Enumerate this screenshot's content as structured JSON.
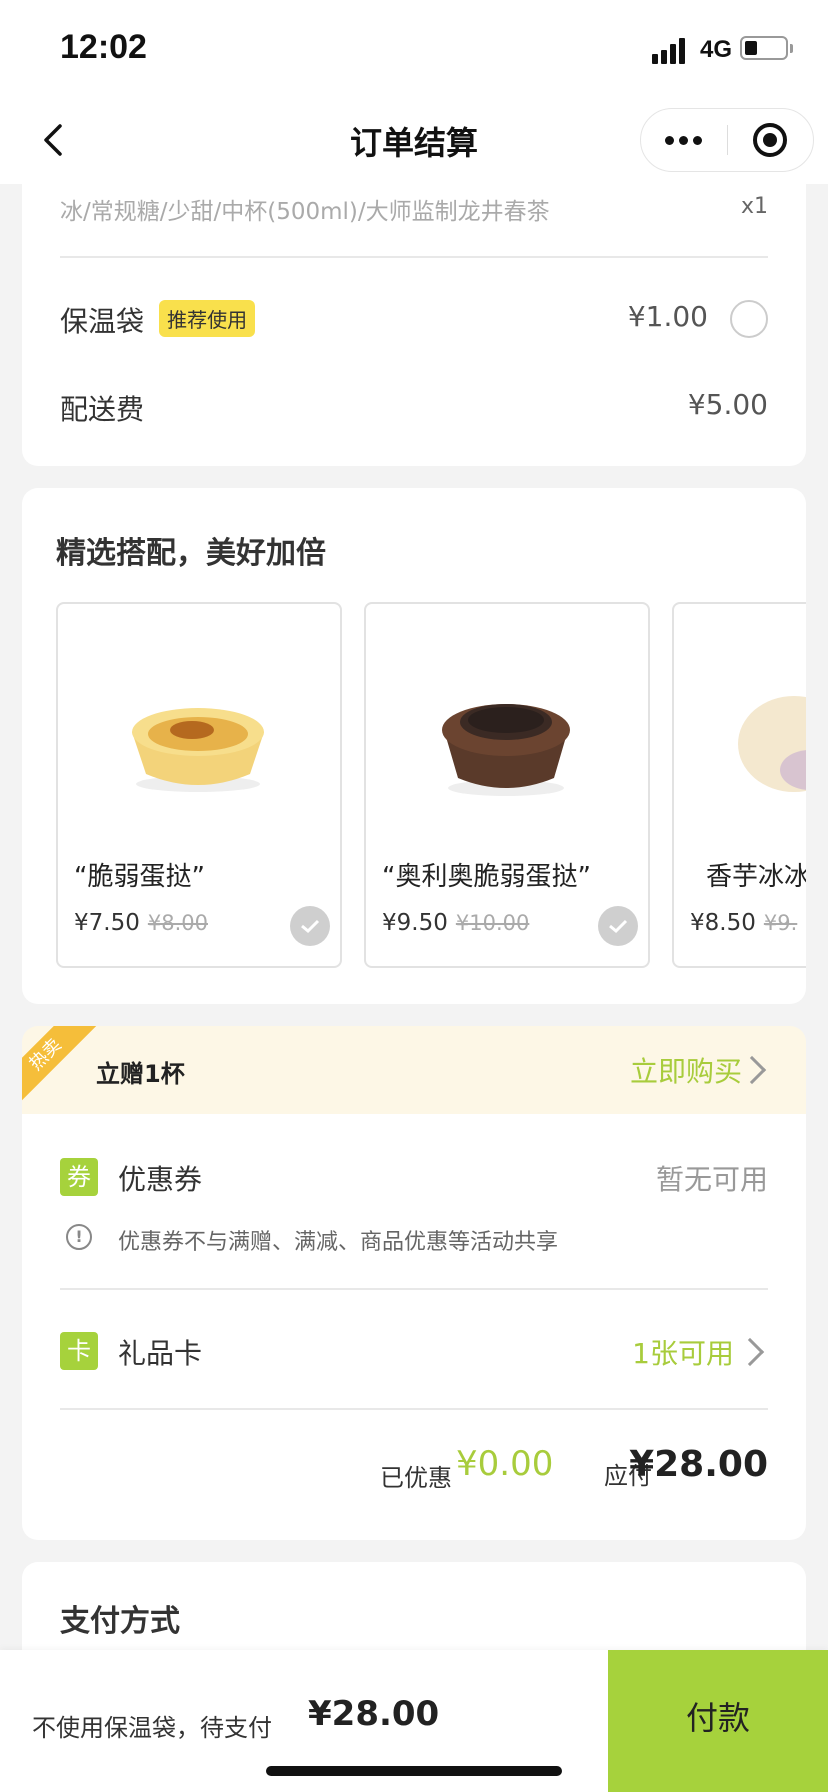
{
  "status_bar": {
    "time": "12:02",
    "network": "4G"
  },
  "nav": {
    "title": "订单结算"
  },
  "order": {
    "spec": "冰/常规糖/少甜/中杯(500ml)/大师监制龙井春茶",
    "qty": "x1",
    "bag_label": "保温袋",
    "bag_tag": "推荐使用",
    "bag_price": "¥1.00",
    "delivery_label": "配送费",
    "delivery_price": "¥5.00"
  },
  "combo": {
    "title": "精选搭配，美好加倍",
    "products": [
      {
        "name": "“脆弱蛋挞”",
        "price": "¥7.50",
        "original": "¥8.00"
      },
      {
        "name": "“奥利奥脆弱蛋挞”",
        "price": "¥9.50",
        "original": "¥10.00"
      },
      {
        "name": "香芋冰冰",
        "price": "¥8.50",
        "original": "¥9."
      }
    ]
  },
  "promo": {
    "ribbon": "热卖",
    "title": "立赠1杯",
    "action": "立即购买"
  },
  "discount": {
    "coupon_icon": "券",
    "coupon_label": "优惠券",
    "coupon_status": "暂无可用",
    "coupon_note": "优惠券不与满赠、满减、商品优惠等活动共享",
    "giftcard_icon": "卡",
    "giftcard_label": "礼品卡",
    "giftcard_status": "1张可用",
    "saved_label": "已优惠",
    "saved_value": "¥0.00",
    "payable_label": "应付",
    "payable_value": "¥28.00"
  },
  "payment": {
    "title": "支付方式"
  },
  "bottom": {
    "summary": "不使用保温袋，待支付",
    "total": "¥28.00",
    "pay_button": "付款"
  },
  "colors": {
    "accent": "#a6d23c",
    "accent_text": "#a8cc3c",
    "tag_yellow": "#f9e04c"
  }
}
